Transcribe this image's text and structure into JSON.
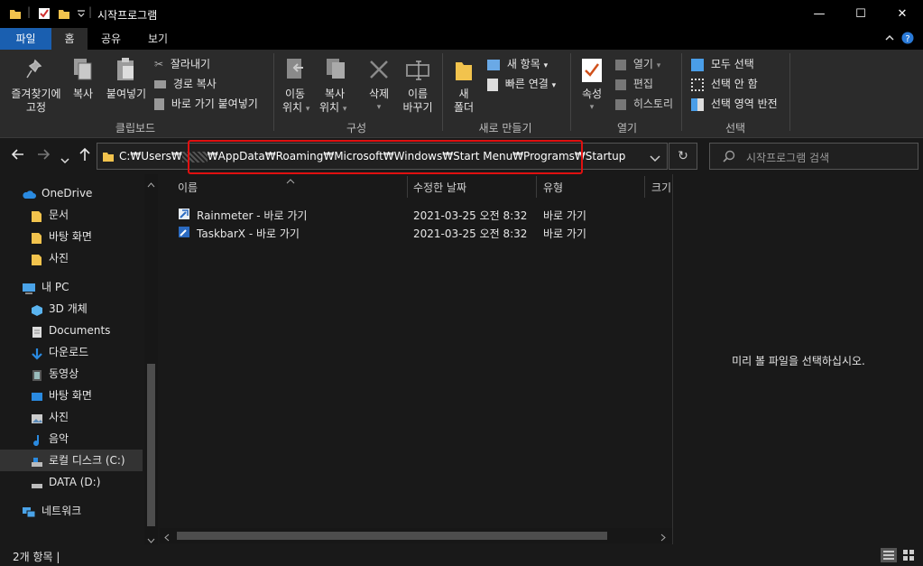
{
  "window": {
    "title": "시작프로그램",
    "minimize": "—",
    "maximize": "☐",
    "close": "✕"
  },
  "ribbon": {
    "tabs": [
      "파일",
      "홈",
      "공유",
      "보기"
    ],
    "groups": {
      "clipboard": {
        "label": "클립보드",
        "pin": "즐겨찾기에\n고정",
        "pin_l1": "즐겨찾기에",
        "pin_l2": "고정",
        "copy": "복사",
        "paste": "붙여넣기",
        "cut": "잘라내기",
        "copy_path": "경로 복사",
        "paste_shortcut": "바로 가기 붙여넣기"
      },
      "organize": {
        "label": "구성",
        "move_l1": "이동",
        "move_l2": "위치",
        "copyto_l1": "복사",
        "copyto_l2": "위치",
        "delete": "삭제",
        "rename_l1": "이름",
        "rename_l2": "바꾸기"
      },
      "new": {
        "label": "새로 만들기",
        "newfolder_l1": "새",
        "newfolder_l2": "폴더",
        "new_item": "새 항목",
        "easy_access": "빠른 연결"
      },
      "open": {
        "label": "열기",
        "properties": "속성",
        "open": "열기",
        "edit": "편집",
        "history": "히스토리"
      },
      "select": {
        "label": "선택",
        "select_all": "모두 선택",
        "select_none": "선택 안 함",
        "invert": "선택 영역 반전"
      }
    }
  },
  "address": {
    "path": "C:₩Users₩　　₩AppData₩Roaming₩Microsoft₩Windows₩Start Menu₩Programs₩Startup",
    "path_a": "C:₩Users₩",
    "path_b": "₩AppData₩Roaming₩Microsoft₩Windows₩Start Menu₩Programs₩Startup",
    "search_placeholder": "시작프로그램 검색"
  },
  "navigation": {
    "items": [
      {
        "label": "OneDrive",
        "icon": "cloud-icon"
      },
      {
        "label": "문서",
        "icon": "folder-icon"
      },
      {
        "label": "바탕 화면",
        "icon": "folder-icon"
      },
      {
        "label": "사진",
        "icon": "folder-icon"
      },
      {
        "label": "내 PC",
        "icon": "computer-icon"
      },
      {
        "label": "3D 개체",
        "icon": "3d-objects-icon"
      },
      {
        "label": "Documents",
        "icon": "documents-icon"
      },
      {
        "label": "다운로드",
        "icon": "download-icon"
      },
      {
        "label": "동영상",
        "icon": "video-icon"
      },
      {
        "label": "바탕 화면",
        "icon": "desktop-icon"
      },
      {
        "label": "사진",
        "icon": "pictures-icon"
      },
      {
        "label": "음악",
        "icon": "music-icon"
      },
      {
        "label": "로컬 디스크 (C:)",
        "icon": "drive-icon"
      },
      {
        "label": "DATA (D:)",
        "icon": "drive-icon"
      },
      {
        "label": "네트워크",
        "icon": "network-icon"
      }
    ]
  },
  "filelist": {
    "columns": [
      "이름",
      "수정한 날짜",
      "유형",
      "크기"
    ],
    "rows": [
      {
        "name": "Rainmeter - 바로 가기",
        "date": "2021-03-25 오전 8:32",
        "type": "바로 가기"
      },
      {
        "name": "TaskbarX - 바로 가기",
        "date": "2021-03-25 오전 8:32",
        "type": "바로 가기"
      }
    ]
  },
  "preview": {
    "message": "미리 볼 파일을 선택하십시오."
  },
  "status": {
    "count": "2개 항목  |"
  }
}
